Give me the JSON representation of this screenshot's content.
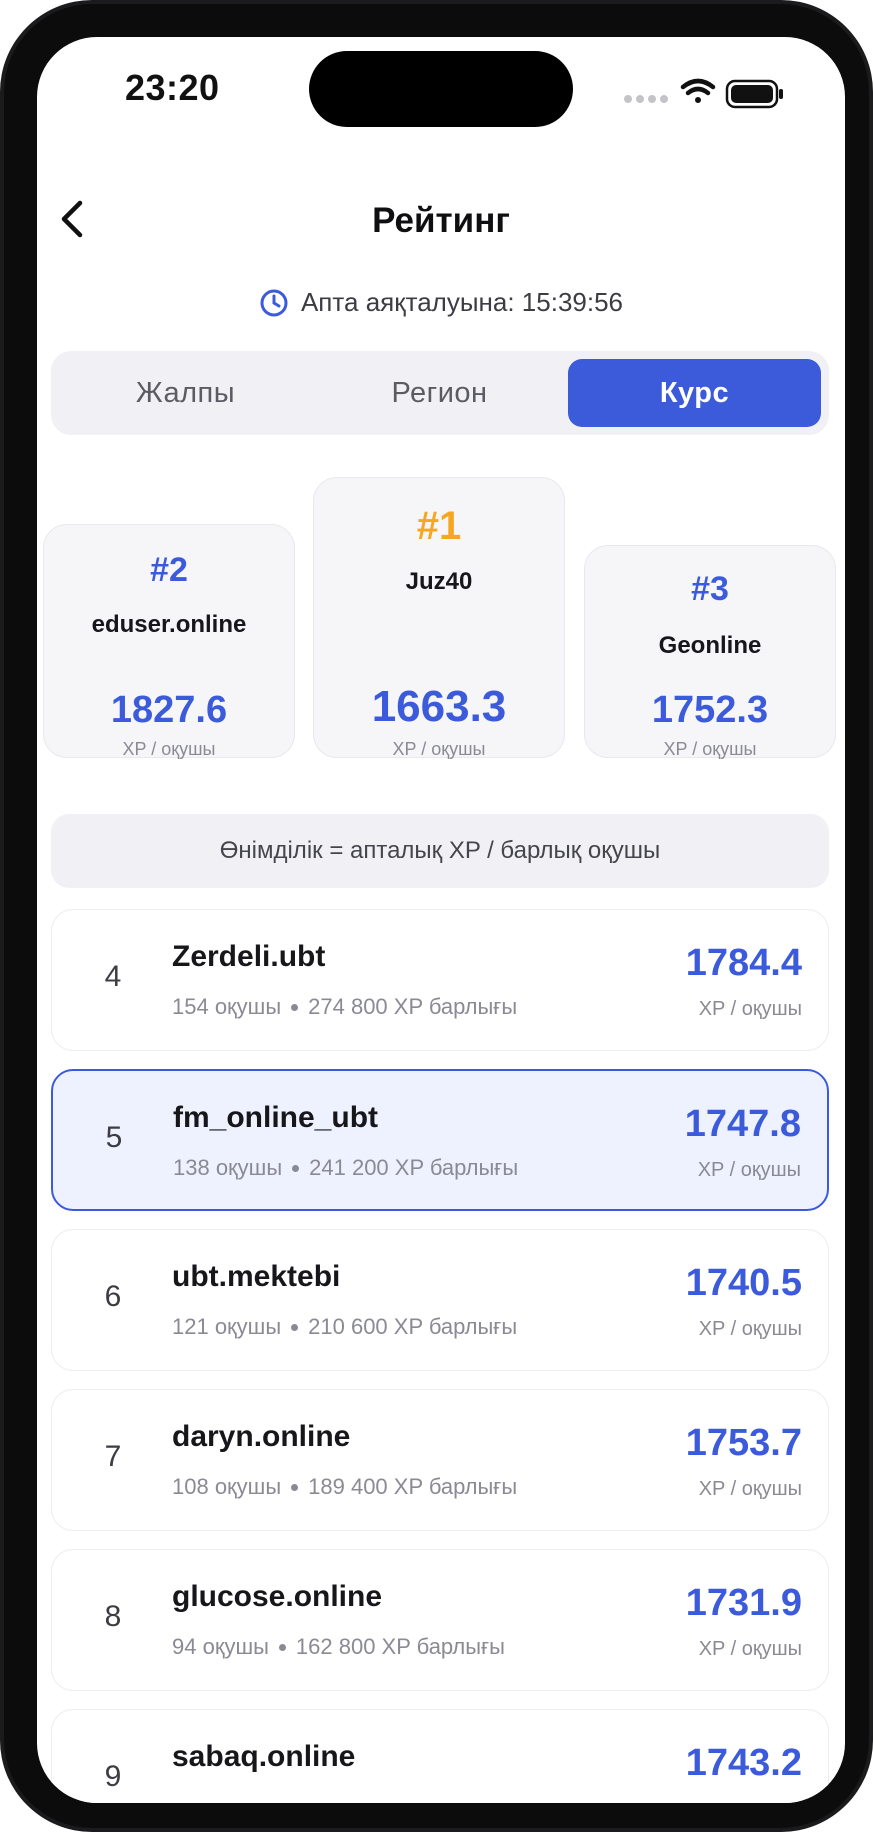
{
  "status_bar": {
    "time": "23:20"
  },
  "header": {
    "title": "Рейтинг"
  },
  "timer": {
    "label": "Апта аяқталуына: 15:39:56"
  },
  "tabs": [
    {
      "label": "Жалпы",
      "active": false
    },
    {
      "label": "Регион",
      "active": false
    },
    {
      "label": "Курс",
      "active": true
    }
  ],
  "podium": {
    "first": {
      "rank": "#1",
      "name": "Juz40",
      "value": "1663.3",
      "unit": "XP / оқушы"
    },
    "second": {
      "rank": "#2",
      "name": "eduser.online",
      "value": "1827.6",
      "unit": "XP / оқушы"
    },
    "third": {
      "rank": "#3",
      "name": "Geonline",
      "value": "1752.3",
      "unit": "XP / оқушы"
    }
  },
  "formula": "Өнімділік = апталық XP / барлық оқушы",
  "ranking": [
    {
      "rank": "4",
      "name": "Zerdeli.ubt",
      "students": "154 оқушы",
      "total_xp": "274 800 XP барлығы",
      "value": "1784.4",
      "unit": "XP / оқушы",
      "highlighted": false
    },
    {
      "rank": "5",
      "name": "fm_online_ubt",
      "students": "138 оқушы",
      "total_xp": "241 200 XP барлығы",
      "value": "1747.8",
      "unit": "XP / оқушы",
      "highlighted": true
    },
    {
      "rank": "6",
      "name": "ubt.mektebi",
      "students": "121 оқушы",
      "total_xp": "210 600 XP барлығы",
      "value": "1740.5",
      "unit": "XP / оқушы",
      "highlighted": false
    },
    {
      "rank": "7",
      "name": "daryn.online",
      "students": "108 оқушы",
      "total_xp": "189 400 XP барлығы",
      "value": "1753.7",
      "unit": "XP / оқушы",
      "highlighted": false
    },
    {
      "rank": "8",
      "name": "glucose.online",
      "students": "94 оқушы",
      "total_xp": "162 800 XP барлығы",
      "value": "1731.9",
      "unit": "XP / оқушы",
      "highlighted": false
    },
    {
      "rank": "9",
      "name": "sabaq.online",
      "value": "1743.2",
      "highlighted": false
    }
  ],
  "colors": {
    "accent": "#3b5bdb",
    "gold": "#f5a623",
    "highlight_bg": "#eef2fe"
  },
  "icons": {
    "back": "chevron-left-icon",
    "timer": "clock-icon",
    "signal": "cellular-signal-icon",
    "wifi": "wifi-icon",
    "battery": "battery-icon"
  }
}
